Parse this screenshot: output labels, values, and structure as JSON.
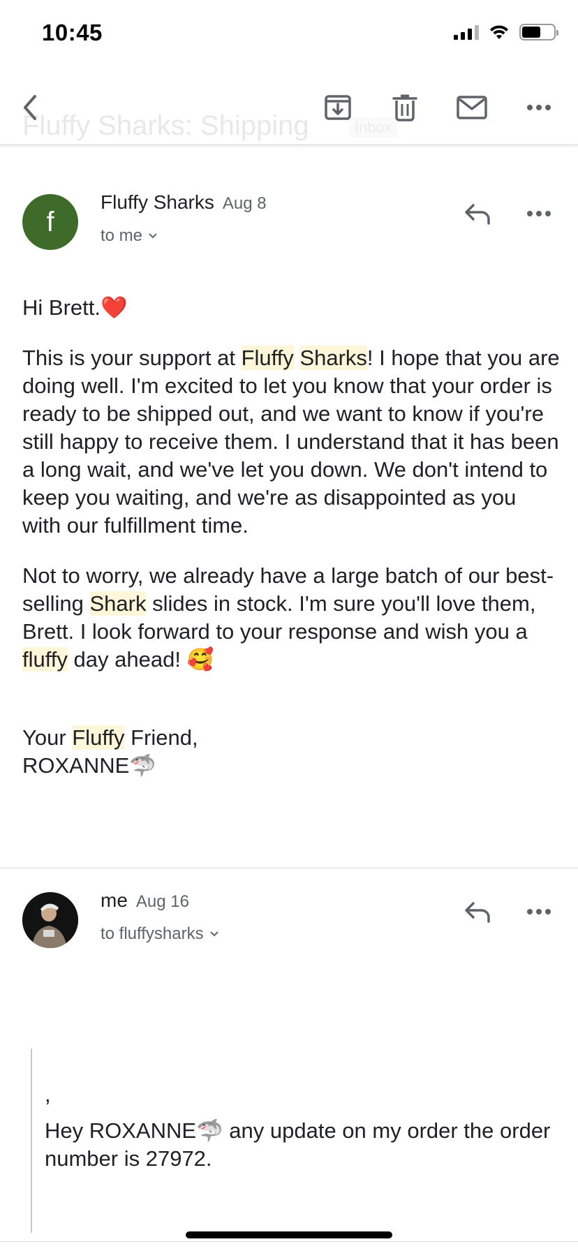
{
  "status_bar": {
    "time": "10:45"
  },
  "thread": {
    "subject": "Fluffy Sharks: Shipping",
    "label": "Inbox"
  },
  "messages": [
    {
      "sender": "Fluffy Sharks",
      "date": "Aug 8",
      "avatar_letter": "f",
      "avatar_color": "#3f6b2a",
      "recipients": "to me",
      "body": {
        "greeting": "Hi Brett.",
        "greeting_emoji": "❤️",
        "p1_a": "This is your support at ",
        "p1_hl1": "Fluffy",
        "p1_space": " ",
        "p1_hl2": "Sharks",
        "p1_b": "! I hope that you are doing well. I'm excited to let you know that your order is ready to be shipped out, and we want to know if you're still happy to receive them. I understand that it has been a long wait, and we've let you down. We don't intend to keep you waiting, and we're as disappointed as you with our fulfillment time.",
        "p2_a": "Not to worry, we already have a large batch of our best-selling ",
        "p2_hl1": "Shark",
        "p2_b": " slides in stock. I'm sure you'll love them, Brett. I look forward to your response and wish you a ",
        "p2_hl2": "fluffy",
        "p2_c": " day ahead! ",
        "p2_emoji": "🥰",
        "sig_a": "Your ",
        "sig_hl": "Fluffy",
        "sig_b": " Friend,",
        "sig_name": "ROXANNE",
        "sig_emoji": "🦈"
      }
    },
    {
      "sender": "me",
      "date": "Aug 16",
      "recipients": "to fluffysharks",
      "body": {
        "comma": ",",
        "text_a": "Hey ROXANNE",
        "text_emoji": "🦈",
        "text_b": " any update on my order the order number is 27972."
      }
    }
  ],
  "colors": {
    "highlight": "#fdf6d8",
    "icon": "#5f6368",
    "divider": "#dadce0"
  },
  "icons": [
    "back-icon",
    "archive-icon",
    "trash-icon",
    "mail-icon",
    "more-icon",
    "reply-icon",
    "chevron-down-icon"
  ]
}
